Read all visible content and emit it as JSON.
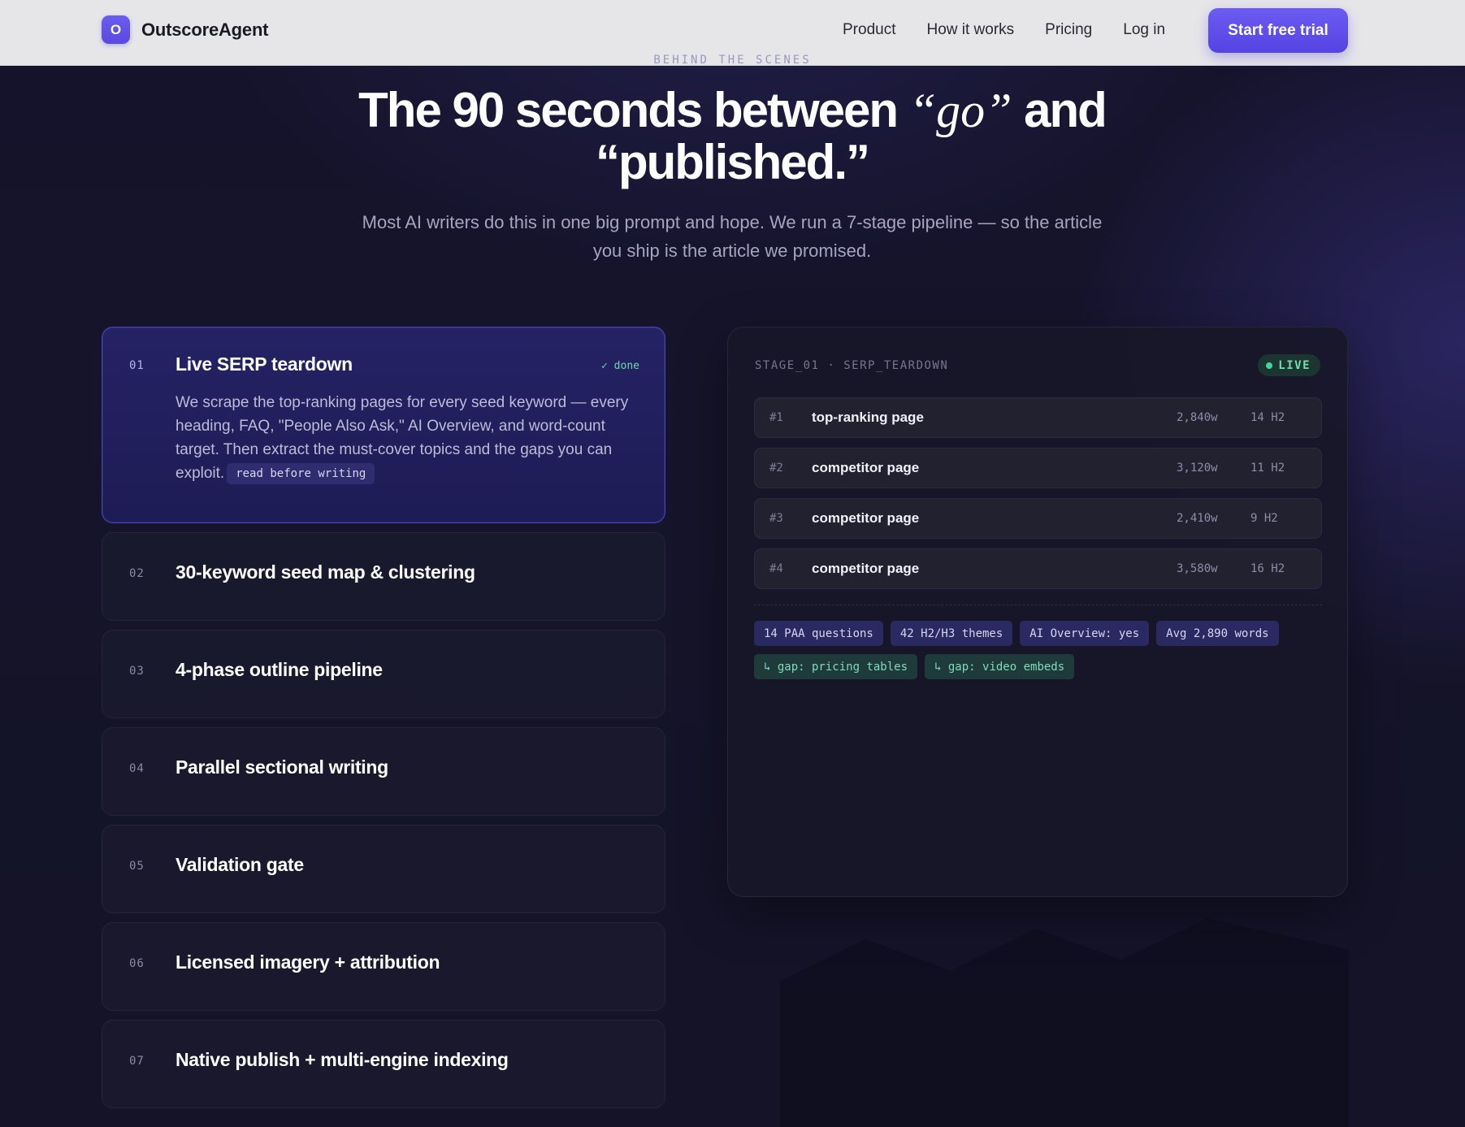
{
  "nav": {
    "brand_initial": "O",
    "brand_name": "OutscoreAgent",
    "links": [
      "Product",
      "How it works",
      "Pricing",
      "Log in"
    ],
    "cta": "Start free trial"
  },
  "hero": {
    "eyebrow": "BEHIND THE SCENES",
    "title_part1": "The 90 seconds between ",
    "title_italic": "“go”",
    "title_part2": " and “published.”",
    "subtitle": "Most AI writers do this in one big prompt and hope. We run a 7-stage pipeline — so the article you ship is the article we promised."
  },
  "steps": [
    {
      "num": "01",
      "title": "Live SERP teardown",
      "status": "✓ done",
      "description": "We scrape the top-ranking pages for every seed keyword — every heading, FAQ, \"People Also Ask,\" AI Overview, and word-count target. Then extract the must-cover topics and the gaps you can exploit.",
      "tag": "read before writing"
    },
    {
      "num": "02",
      "title": "30-keyword seed map & clustering"
    },
    {
      "num": "03",
      "title": "4-phase outline pipeline"
    },
    {
      "num": "04",
      "title": "Parallel sectional writing"
    },
    {
      "num": "05",
      "title": "Validation gate"
    },
    {
      "num": "06",
      "title": "Licensed imagery + attribution"
    },
    {
      "num": "07",
      "title": "Native publish + multi-engine indexing"
    }
  ],
  "panel": {
    "header": "STAGE_01 · SERP_TEARDOWN",
    "live_label": "LIVE",
    "rows": [
      {
        "rank": "#1",
        "label": "top-ranking page",
        "words": "2,840w",
        "h2": "14 H2"
      },
      {
        "rank": "#2",
        "label": "competitor page",
        "words": "3,120w",
        "h2": "11 H2"
      },
      {
        "rank": "#3",
        "label": "competitor page",
        "words": "2,410w",
        "h2": "9 H2"
      },
      {
        "rank": "#4",
        "label": "competitor page",
        "words": "3,580w",
        "h2": "16 H2"
      }
    ],
    "stats": [
      "14 PAA questions",
      "42 H2/H3 themes",
      "AI Overview: yes",
      "Avg 2,890 words"
    ],
    "gaps": [
      "↳ gap: pricing tables",
      "↳ gap: video embeds"
    ]
  },
  "colors": {
    "accent": "#5a48e0",
    "live_green": "#46d39a",
    "background": "#15132b"
  }
}
